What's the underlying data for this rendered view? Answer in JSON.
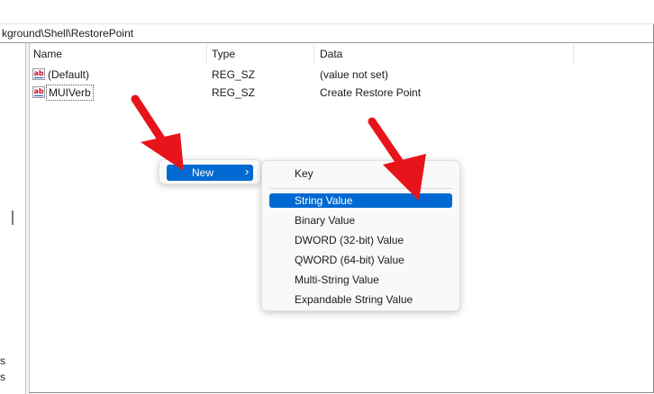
{
  "address": "kground\\Shell\\RestorePoint",
  "columns": {
    "name": "Name",
    "type": "Type",
    "data": "Data"
  },
  "rows": [
    {
      "name": "(Default)",
      "type": "REG_SZ",
      "data": "(value not set)"
    },
    {
      "name": "MUIVerb",
      "type": "REG_SZ",
      "data": "Create Restore Point"
    }
  ],
  "left_fragments": [
    "s",
    "s"
  ],
  "context_menu": {
    "new_label": "New",
    "new_chevron": "›"
  },
  "submenu": {
    "items": [
      "Key",
      "String Value",
      "Binary Value",
      "DWORD (32-bit) Value",
      "QWORD (64-bit) Value",
      "Multi-String Value",
      "Expandable String Value"
    ],
    "highlighted": "String Value"
  },
  "colors": {
    "highlight": "#0069d1",
    "arrow": "#e8141b",
    "icon_red": "#c8102e"
  },
  "icons": {
    "value_icon": "ab-icon"
  }
}
